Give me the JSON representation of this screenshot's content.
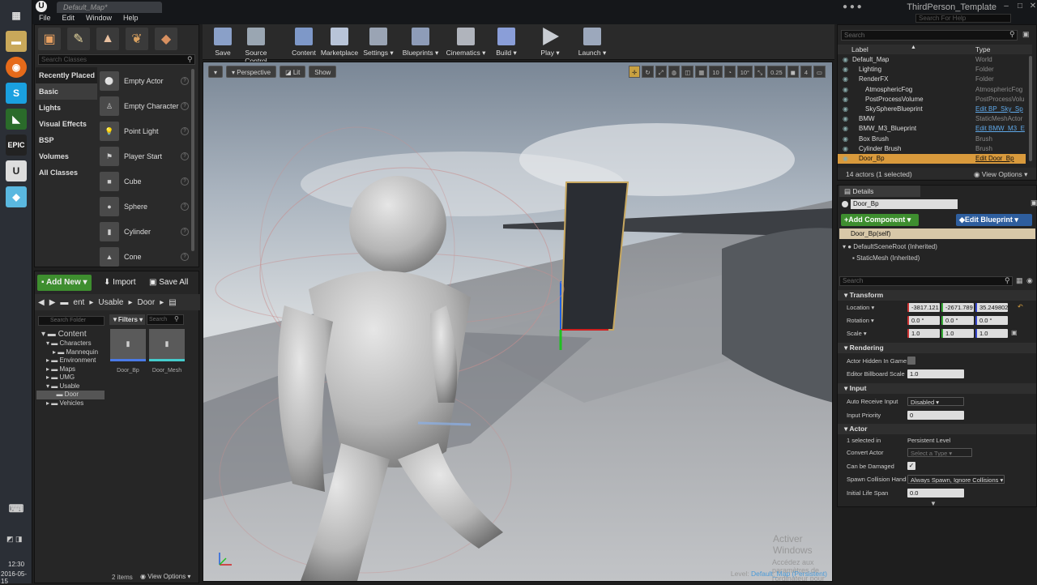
{
  "taskbar": {
    "clock": "12:30",
    "date": "2016-05-15"
  },
  "window": {
    "tab": "Default_Map*",
    "project": "ThirdPerson_Template",
    "help_search": "Search For Help"
  },
  "menu": [
    "File",
    "Edit",
    "Window",
    "Help"
  ],
  "modes": {
    "search_placeholder": "Search Classes",
    "categories": [
      "Recently Placed",
      "Basic",
      "Lights",
      "Visual Effects",
      "BSP",
      "Volumes",
      "All Classes"
    ],
    "items": [
      "Empty Actor",
      "Empty Character",
      "Point Light",
      "Player Start",
      "Cube",
      "Sphere",
      "Cylinder",
      "Cone"
    ]
  },
  "content_browser": {
    "add_new": "Add New",
    "import": "Import",
    "save_all": "Save All",
    "path": [
      "ent",
      "Usable",
      "Door"
    ],
    "folder_search": "Search Folder",
    "filters": "Filters",
    "asset_search": "Search",
    "tree": [
      "Content",
      "Characters",
      "Mannequin",
      "Environment",
      "Maps",
      "UMG",
      "Usable",
      "Door",
      "Vehicles"
    ],
    "assets": [
      "Door_Bp",
      "Door_Mesh"
    ],
    "item_count": "2 items",
    "view_options": "View Options"
  },
  "toolbar": [
    "Save",
    "Source Control",
    "Content",
    "Marketplace",
    "Settings",
    "Blueprints",
    "Cinematics",
    "Build",
    "Play",
    "Launch"
  ],
  "viewport": {
    "perspective": "Perspective",
    "lit": "Lit",
    "show": "Show",
    "grid": "10",
    "angle": "10°",
    "scale": "0.25",
    "cam": "4",
    "level_label": "Level:",
    "level_name": "Default_Map (Persistent)",
    "watermark_title": "Activer Windows",
    "watermark_text": "Accédez aux paramètres de l'ordinateur pour activer Windows."
  },
  "outliner": {
    "search_placeholder": "Search",
    "col_label": "Label",
    "col_type": "Type",
    "rows": [
      {
        "name": "Default_Map",
        "type": "World",
        "indent": 1,
        "link": false
      },
      {
        "name": "Lighting",
        "type": "Folder",
        "indent": 2,
        "link": false
      },
      {
        "name": "RenderFX",
        "type": "Folder",
        "indent": 2,
        "link": false
      },
      {
        "name": "AtmosphericFog",
        "type": "AtmosphericFog",
        "indent": 3,
        "link": false
      },
      {
        "name": "PostProcessVolume",
        "type": "PostProcessVolu",
        "indent": 3,
        "link": false
      },
      {
        "name": "SkySphereBlueprint",
        "type": "Edit BP_Sky_Sp",
        "indent": 3,
        "link": true
      },
      {
        "name": "BMW",
        "type": "StaticMeshActor",
        "indent": 2,
        "link": false
      },
      {
        "name": "BMW_M3_Blueprint",
        "type": "Edit BMW_M3_E",
        "indent": 2,
        "link": true
      },
      {
        "name": "Box Brush",
        "type": "Brush",
        "indent": 2,
        "link": false
      },
      {
        "name": "Cylinder Brush",
        "type": "Brush",
        "indent": 2,
        "link": false
      },
      {
        "name": "Door_Bp",
        "type": "Edit Door_Bp",
        "indent": 2,
        "link": true
      }
    ],
    "selected_index": 10,
    "count": "14 actors (1 selected)",
    "view_options": "View Options"
  },
  "details": {
    "tab": "Details",
    "name": "Door_Bp",
    "add_component": "Add Component",
    "edit_blueprint": "Edit Blueprint",
    "self": "Door_Bp(self)",
    "components": [
      "DefaultSceneRoot (Inherited)",
      "StaticMesh (Inherited)"
    ],
    "search_placeholder": "Search",
    "transform": "Transform",
    "location_label": "Location",
    "location": [
      "-3817.121",
      "-2671.789",
      "35.249802"
    ],
    "rotation_label": "Rotation",
    "rotation": [
      "0.0 °",
      "0.0 °",
      "0.0 °"
    ],
    "scale_label": "Scale",
    "scale": [
      "1.0",
      "1.0",
      "1.0"
    ],
    "rendering": "Rendering",
    "hidden_label": "Actor Hidden In Game",
    "billboard_label": "Editor Billboard Scale",
    "billboard": "1.0",
    "input": "Input",
    "auto_input_label": "Auto Receive Input",
    "auto_input": "Disabled",
    "priority_label": "Input Priority",
    "priority": "0",
    "actor": "Actor",
    "selected_in_label": "1 selected in",
    "selected_in": "Persistent Level",
    "convert_label": "Convert Actor",
    "convert": "Select a Type",
    "damage_label": "Can be Damaged",
    "spawn_label": "Spawn Collision Handling",
    "spawn": "Always Spawn, Ignore Collisions",
    "lifespan_label": "Initial Life Span",
    "lifespan": "0.0"
  }
}
